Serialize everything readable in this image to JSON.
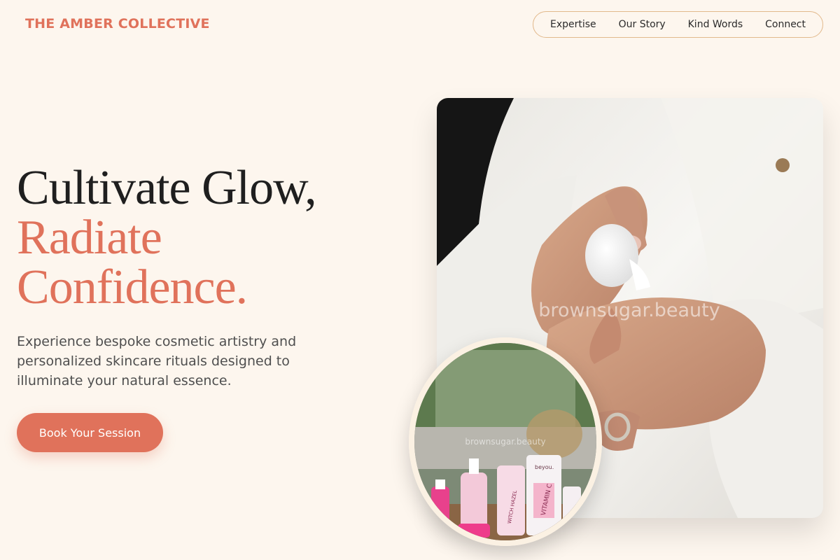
{
  "brand": {
    "name": "THE AMBER COLLECTIVE"
  },
  "nav": {
    "items": [
      {
        "label": "Expertise"
      },
      {
        "label": "Our Story"
      },
      {
        "label": "Kind Words"
      },
      {
        "label": "Connect"
      }
    ]
  },
  "hero": {
    "headline_line1": "Cultivate Glow,",
    "headline_line2": "Radiate",
    "headline_line3": "Confidence.",
    "lede": "Experience bespoke cosmetic artistry and personalized skincare rituals designed to illuminate your natural essence.",
    "cta_label": "Book Your Session"
  },
  "images": {
    "main_watermark": "brownsugar.beauty",
    "inset_watermark": "brownsugar.beauty",
    "inset_product_brand": "beyou.",
    "inset_product_text": "VITAMIN C",
    "inset_product_text2": "WITCH HAZEL"
  },
  "colors": {
    "accent": "#e0725b",
    "background": "#fdf6ee",
    "nav_border": "#e2b98c"
  }
}
